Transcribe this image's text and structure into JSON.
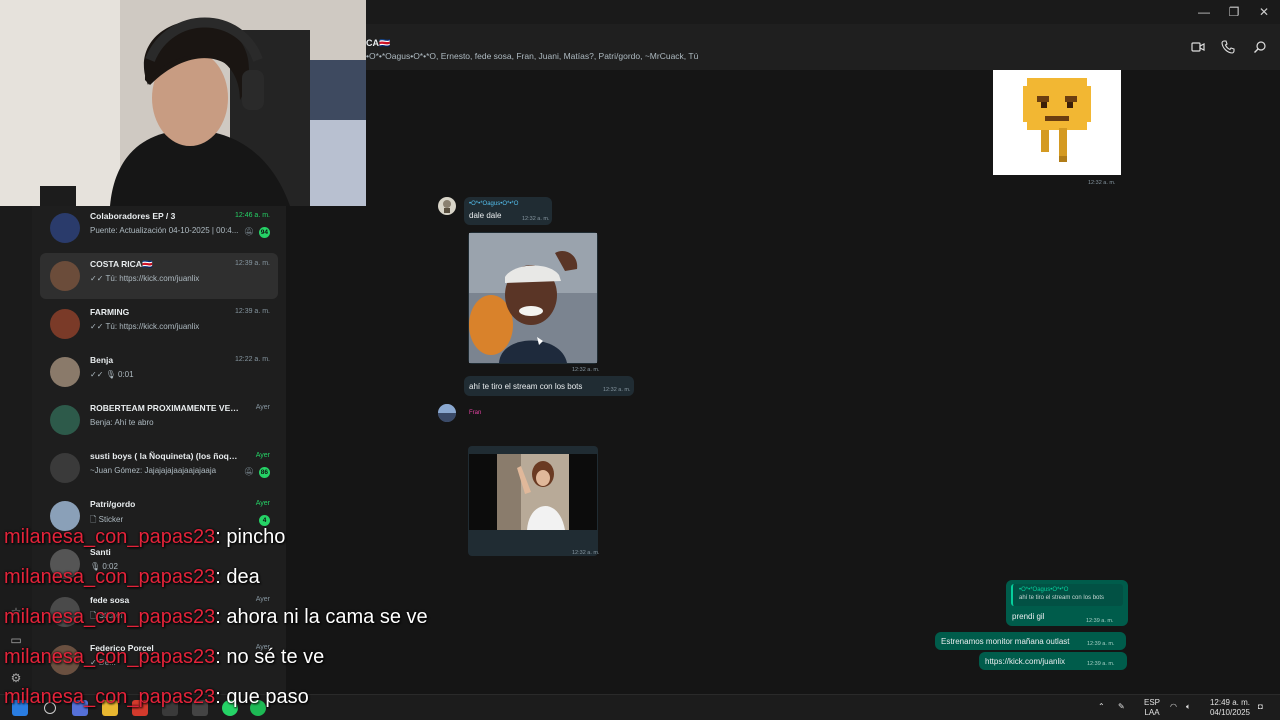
{
  "window": {
    "minimize": "—",
    "maximize": "❐",
    "close": "✕"
  },
  "conversation": {
    "title": "CA🇨🇷",
    "members": "•O*•*Oagus•O*•*O, Ernesto, fede sosa, Fran, Juani, Matías?, Patri/gordo, ~MrCuack, Tú",
    "icons": [
      "video-call-icon",
      "phone-icon",
      "search-icon"
    ]
  },
  "chats": [
    {
      "name": "Colaboradores EP / 3",
      "time": "12:46 a. m.",
      "time_green": true,
      "preview": "Puente: Actualización 04-10-2025 | 00:4...",
      "muted": true,
      "badge": "94",
      "avatar": "#2a3b6b"
    },
    {
      "name": "COSTA RICA🇨🇷",
      "time": "12:39 a. m.",
      "time_green": false,
      "preview": "✓✓ Tú: https://kick.com/juanlix",
      "muted": false,
      "badge": "",
      "avatar": "#6b4c3a"
    },
    {
      "name": "FARMING",
      "time": "12:39 a. m.",
      "time_green": false,
      "preview": "✓✓ Tú: https://kick.com/juanlix",
      "muted": false,
      "badge": "",
      "avatar": "#7a3a28"
    },
    {
      "name": "Benja",
      "time": "12:22 a. m.",
      "time_green": false,
      "preview": "✓✓ 🎙 0:01",
      "muted": false,
      "badge": "",
      "avatar": "#8a7a6a"
    },
    {
      "name": "ROBERTEAM PROXIMAMENTE VEGETTA...",
      "time": "Ayer",
      "time_green": false,
      "preview": "Benja: Ahí te abro",
      "muted": false,
      "badge": "",
      "avatar": "#2d5a4a"
    },
    {
      "name": "susti boys ( la Ñoquineta) (los ñoqui bo...",
      "time": "Ayer",
      "time_green": true,
      "preview": "~Juan Gómez: Jajajajajaajaajajaaja",
      "muted": true,
      "badge": "86",
      "avatar": "#3a3a3a"
    },
    {
      "name": "Patri/gordo",
      "time": "Ayer",
      "time_green": true,
      "preview": "🗋 Sticker",
      "muted": false,
      "badge": "4",
      "avatar": "#8aa0b8"
    },
    {
      "name": "Santi",
      "time": "",
      "time_green": false,
      "preview": "🎙 0:02",
      "muted": false,
      "badge": "",
      "avatar": "#555555"
    },
    {
      "name": "fede sosa",
      "time": "Ayer",
      "time_green": false,
      "preview": "🗋 Sticker",
      "muted": false,
      "badge": "",
      "avatar": "#4a4a4a"
    },
    {
      "name": "Federico Porcel",
      "time": "Ayer",
      "time_green": false,
      "preview": "✓ De...",
      "muted": false,
      "badge": "",
      "avatar": "#6a5040"
    }
  ],
  "messages": {
    "top_sticker_time": "12:32 a. m.",
    "sender1": "•O*•*Oagus•O*•*O",
    "text1": "dale dale",
    "time1": "12:32 a. m.",
    "image1_time": "12:32 a. m.",
    "text2": "ahí te tiro el stream con los bots",
    "time2": "12:32 a. m.",
    "sender2": "Fran",
    "image2_time": "12:32 a. m.",
    "reply_author": "•O*•*Oagus•O*•*O",
    "reply_quote": "ahí te tiro el stream con los bots",
    "out1": "prendi gil",
    "out1_time": "12:39 a. m.",
    "out2": "Estrenamos monitor mañana outlast",
    "out2_time": "12:39 a. m.",
    "out3": "https://kick.com/juanlix",
    "out3_time": "12:39 a. m."
  },
  "stream_chat": [
    {
      "user": "milanesa_con_papas23",
      "message": "pincho"
    },
    {
      "user": "milanesa_con_papas23",
      "message": "dea"
    },
    {
      "user": "milanesa_con_papas23",
      "message": "ahora ni la cama se ve"
    },
    {
      "user": "milanesa_con_papas23",
      "message": "no sé te ve"
    },
    {
      "user": "milanesa_con_papas23",
      "message": "que paso"
    }
  ],
  "taskbar": {
    "lang_top": "ESP",
    "lang_bottom": "LAA",
    "time": "12:49 a. m.",
    "date": "04/10/2025"
  }
}
